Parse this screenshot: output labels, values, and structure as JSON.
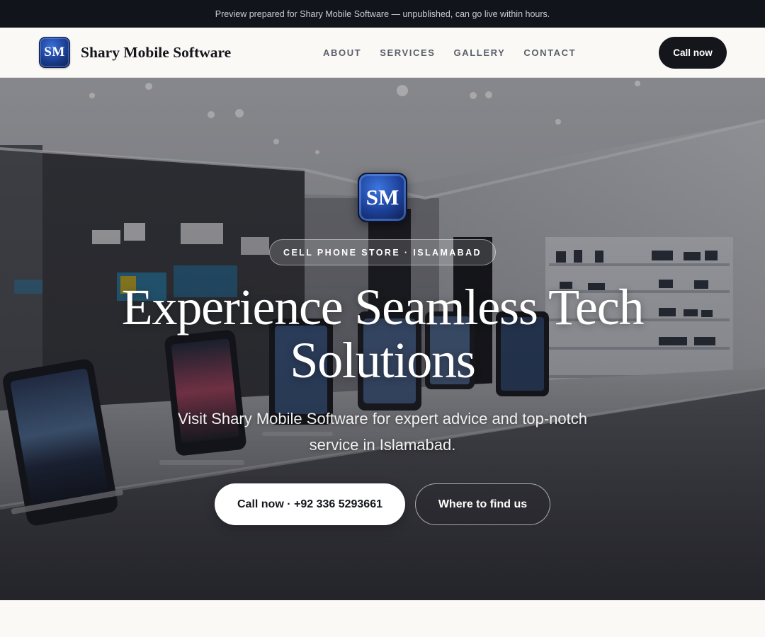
{
  "preview_banner": {
    "text": "Preview prepared for Shary Mobile Software — unpublished, can go live within hours."
  },
  "header": {
    "logo_initials": "SM",
    "brand_name": "Shary Mobile Software",
    "nav": [
      {
        "label": "ABOUT"
      },
      {
        "label": "SERVICES"
      },
      {
        "label": "GALLERY"
      },
      {
        "label": "CONTACT"
      }
    ],
    "call_label": "Call now"
  },
  "hero": {
    "logo_initials": "SM",
    "tag": "CELL PHONE STORE · ISLAMABAD",
    "title": "Experience Seamless Tech Solutions",
    "subtitle": "Visit Shary Mobile Software for expert advice and top-notch service in Islamabad.",
    "primary_button": "Call now · +92 336 5293661",
    "secondary_button": "Where to find us",
    "background_image": "phone-store-interior"
  },
  "colors": {
    "banner_bg": "#11141a",
    "header_bg": "#faf9f6",
    "primary_dark": "#14161b",
    "logo_blue": "#1b3d8f",
    "nav_text": "#5a5f6b"
  }
}
